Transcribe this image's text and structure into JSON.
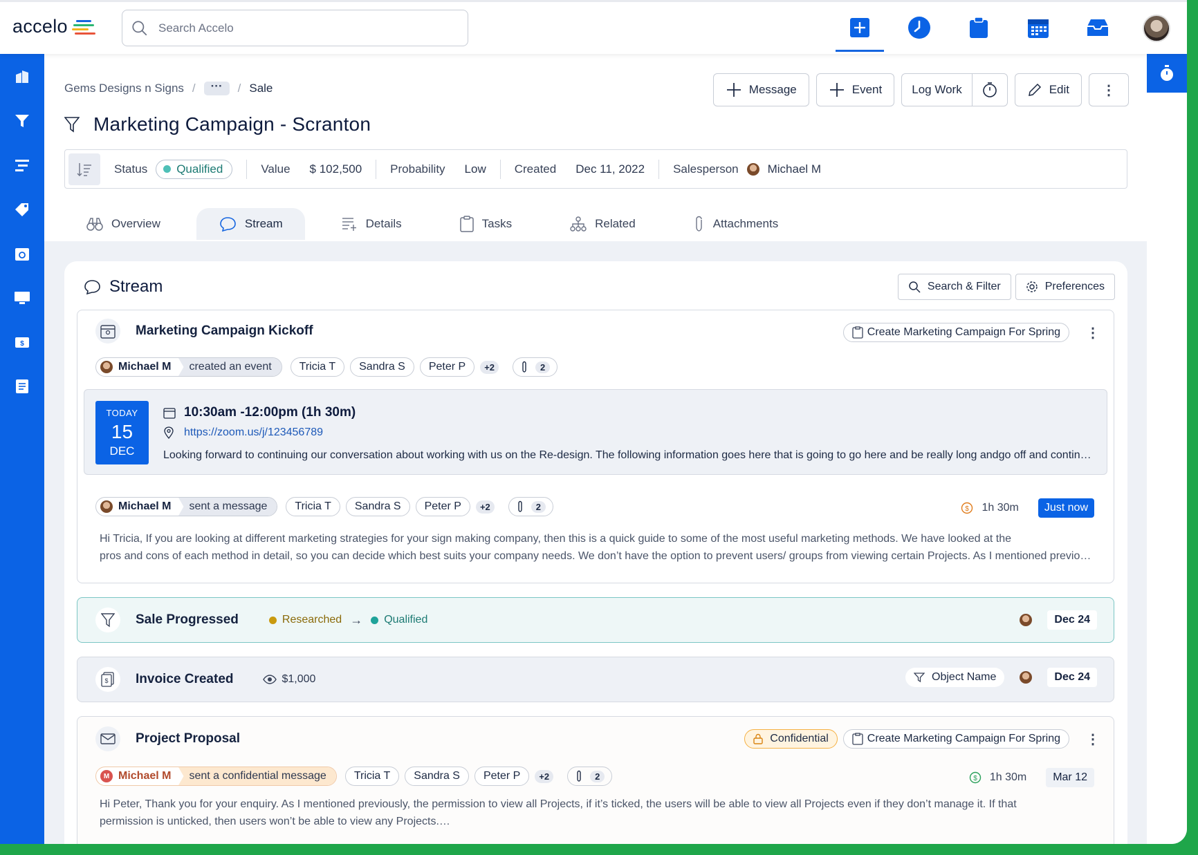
{
  "app": {
    "logo": "accelo",
    "search_placeholder": "Search Accelo"
  },
  "breadcrumb": {
    "company": "Gems Designs n Signs",
    "ellipsis": "···",
    "current": "Sale"
  },
  "header_actions": {
    "message": "Message",
    "event": "Event",
    "log_work": "Log Work",
    "edit": "Edit"
  },
  "title": "Marketing Campaign - Scranton",
  "info": {
    "status_label": "Status",
    "status_value": "Qualified",
    "value_label": "Value",
    "value_value": "$  102,500",
    "probability_label": "Probability",
    "probability_value": "Low",
    "created_label": "Created",
    "created_value": "Dec 11, 2022",
    "salesperson_label": "Salesperson",
    "salesperson_value": "Michael M"
  },
  "tabs": [
    "Overview",
    "Stream",
    "Details",
    "Tasks",
    "Related",
    "Attachments"
  ],
  "active_tab": "Stream",
  "stream": {
    "title": "Stream",
    "search_filter": "Search & Filter",
    "preferences": "Preferences",
    "kickoff": {
      "title": "Marketing Campaign Kickoff",
      "task": "Create Marketing Campaign For Spring",
      "actor": "Michael M",
      "verb": "created an event",
      "people": [
        "Tricia T",
        "Sandra S",
        "Peter P"
      ],
      "more": "+2",
      "attachments": "2",
      "event": {
        "day_label": "TODAY",
        "day": "15",
        "month": "DEC",
        "time": "10:30am -12:00pm  (1h 30m)",
        "link": "https://zoom.us/j/123456789",
        "desc": "Looking forward to continuing our conversation about working with us on the Re-design. The following information goes here that is going to go here and be really long andgo off and continue on past the edge"
      },
      "reply": {
        "actor": "Michael M",
        "verb": "sent a message",
        "people": [
          "Tricia T",
          "Sandra S",
          "Peter P"
        ],
        "more": "+2",
        "attachments": "2",
        "duration": "1h 30m",
        "time_badge": "Just now",
        "line1": "Hi Tricia, If you are looking at different marketing strategies for your sign making company, then this is a quick guide to some of the most useful marketing methods. We have looked at the",
        "line2": "pros and cons of each method in detail, so you can decide which best suits your company needs. We don’t have the option to prevent users/ groups from viewing certain Projects. As I mentioned previously"
      }
    },
    "sale_progressed": {
      "title": "Sale Progressed",
      "from": "Researched",
      "arrow": "→",
      "to": "Qualified",
      "date": "Dec 24"
    },
    "invoice": {
      "title": "Invoice Created",
      "amount": "$1,000",
      "object": "Object Name",
      "date": "Dec 24"
    },
    "proposal": {
      "title": "Project Proposal",
      "confidential": "Confidential",
      "task": "Create Marketing Campaign For Spring",
      "actor": "Michael M",
      "actor_initial": "M",
      "verb": "sent a confidential message",
      "people": [
        "Tricia T",
        "Sandra S",
        "Peter P"
      ],
      "more": "+2",
      "attachments": "2",
      "duration": "1h 30m",
      "date": "Mar 12",
      "line1": "Hi Peter, Thank you for your enquiry. As I mentioned previously, the permission to view all Projects, if it’s ticked, the users will be able to view all Projects even if they don’t manage it. If that",
      "line2": "permission is unticked, then users won’t be able to view any Projects.…"
    }
  },
  "colors": {
    "brand_blue": "#0b63e5",
    "green_frame": "#1fa64a",
    "qualified_teal": "#1fa39a",
    "researched_gold": "#c99a0f",
    "confidential": "#f5b144"
  }
}
